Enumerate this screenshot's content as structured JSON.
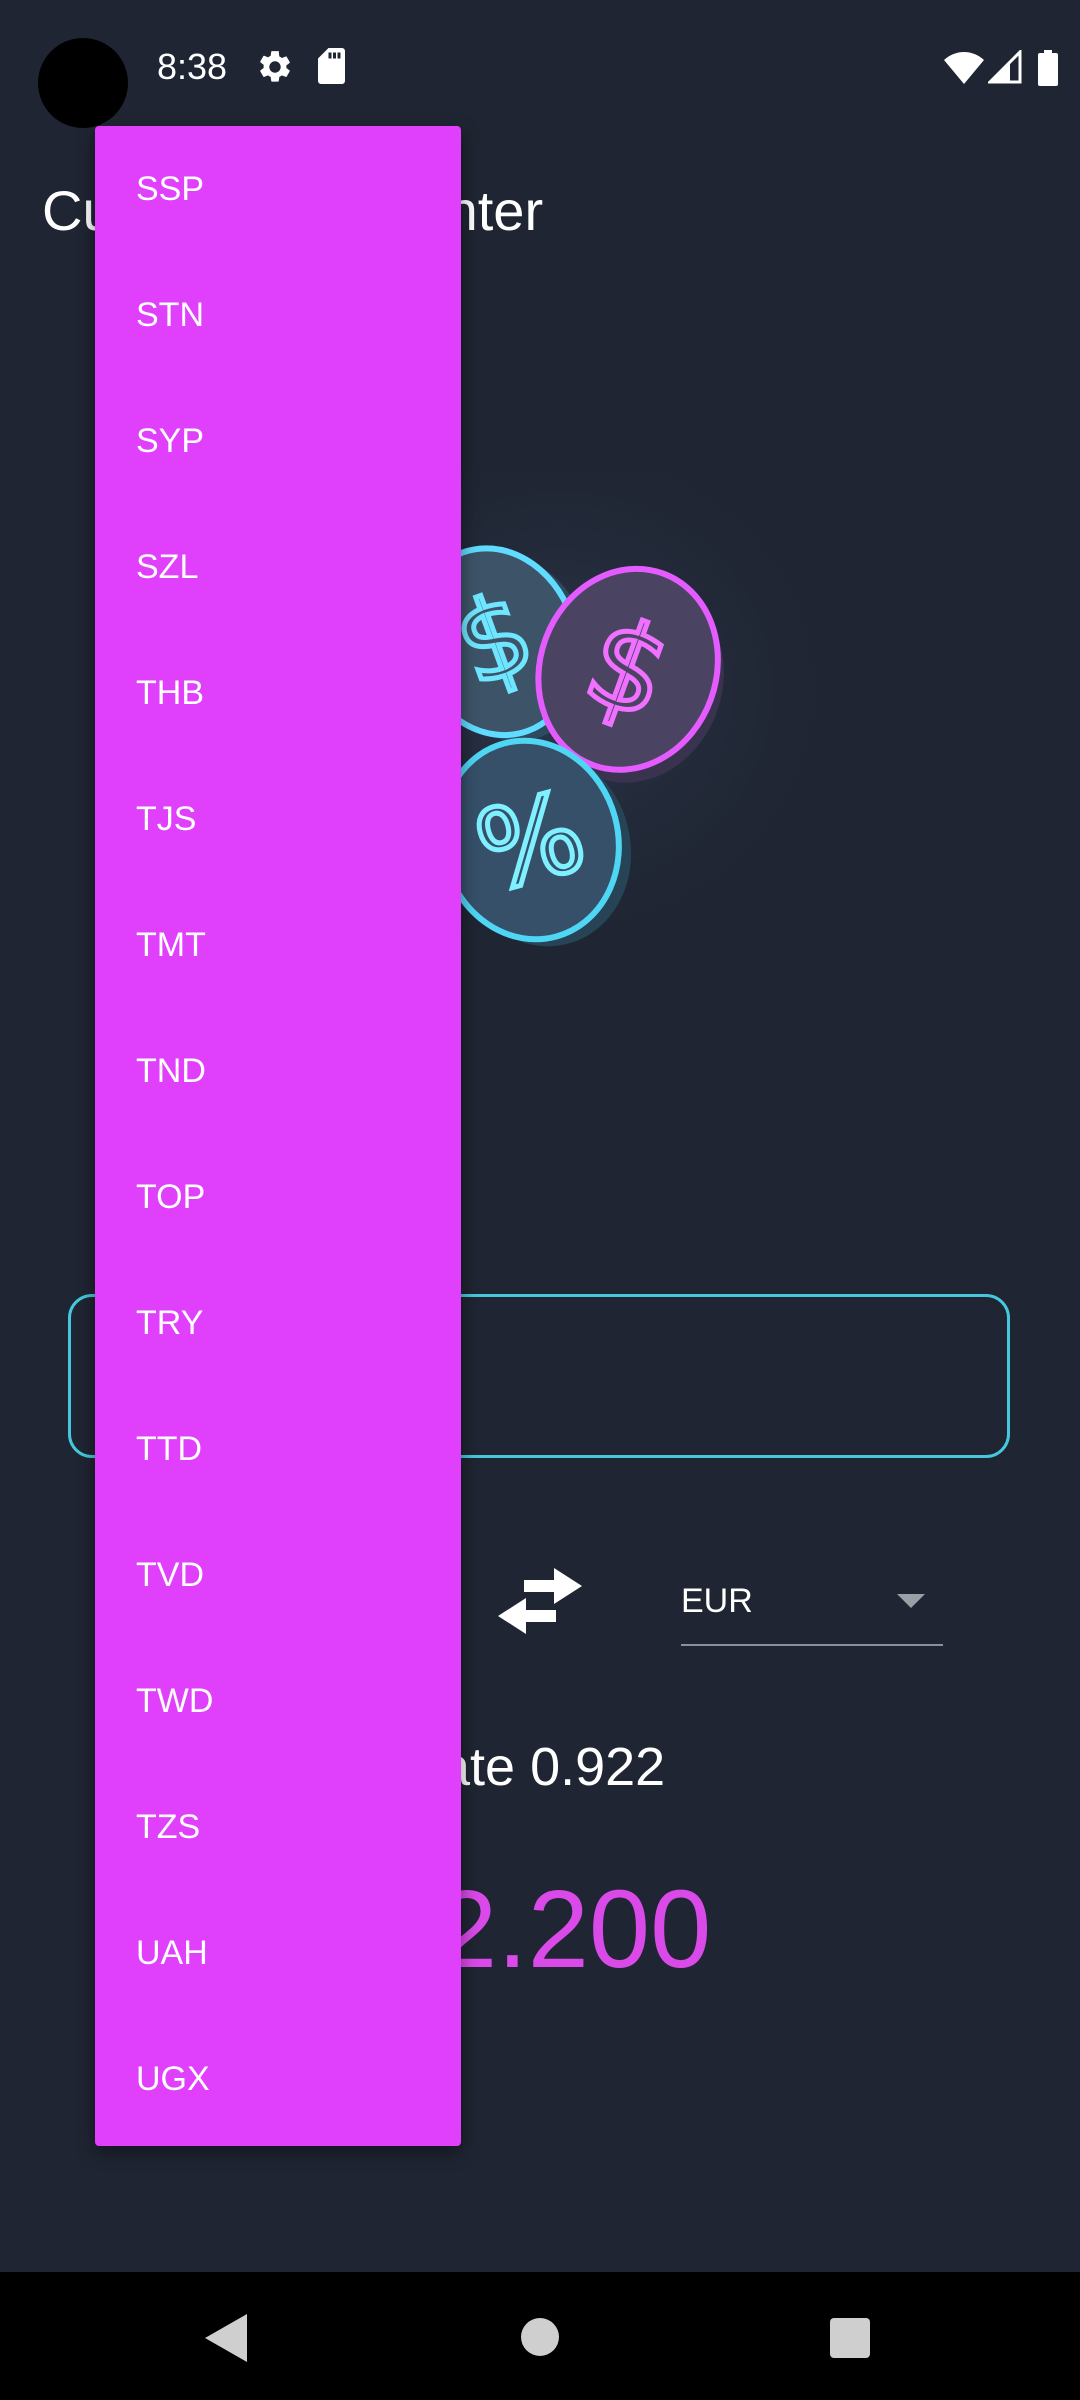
{
  "status_bar": {
    "time": "8:38",
    "icons": [
      "gear-icon",
      "sd-card-icon",
      "wifi-icon",
      "signal-icon",
      "battery-icon"
    ]
  },
  "app": {
    "title_left": "Cu",
    "title_right": "nter"
  },
  "converter": {
    "to_currency": "EUR",
    "rate_text": "ate 0.922",
    "result_text": "2.200"
  },
  "dropdown": {
    "items": [
      "SSP",
      "STN",
      "SYP",
      "SZL",
      "THB",
      "TJS",
      "TMT",
      "TND",
      "TOP",
      "TRY",
      "TTD",
      "TVD",
      "TWD",
      "TZS",
      "UAH",
      "UGX"
    ]
  },
  "colors": {
    "background": "#1f2532",
    "dropdown": "#e040fb",
    "accent_result": "#d94ae8",
    "input_border": "#45c8dc"
  },
  "navbar": {
    "icons": [
      "back-icon",
      "home-icon",
      "recents-icon"
    ]
  }
}
